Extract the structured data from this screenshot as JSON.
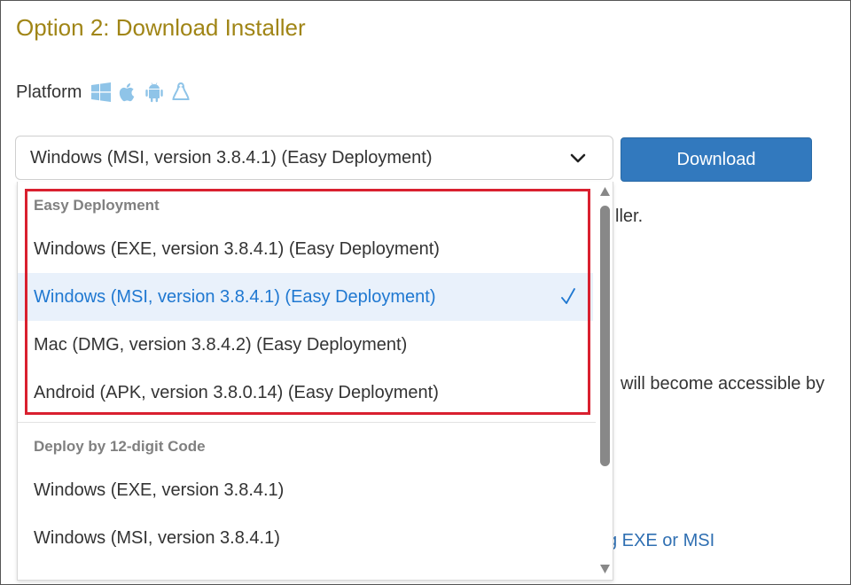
{
  "page": {
    "title": "Option 2: Download Installer",
    "platform_label": "Platform",
    "platform_icons": [
      "windows-icon",
      "apple-icon",
      "android-icon",
      "linux-icon"
    ]
  },
  "select": {
    "value": "Windows (MSI, version 3.8.4.1) (Easy Deployment)"
  },
  "download_button": {
    "label": "Download"
  },
  "background_text": {
    "line1_fragment": "ller.",
    "line2_fragment": "will become accessible by",
    "link_fragment": "g EXE or MSI"
  },
  "dropdown": {
    "groups": [
      {
        "header": "Easy Deployment",
        "options": [
          {
            "label": "Windows (EXE, version 3.8.4.1) (Easy Deployment)",
            "selected": false
          },
          {
            "label": "Windows (MSI, version 3.8.4.1) (Easy Deployment)",
            "selected": true
          },
          {
            "label": "Mac (DMG, version 3.8.4.2) (Easy Deployment)",
            "selected": false
          },
          {
            "label": "Android (APK, version 3.8.0.14) (Easy Deployment)",
            "selected": false
          }
        ]
      },
      {
        "header": "Deploy by 12-digit Code",
        "options": [
          {
            "label": "Windows (EXE, version 3.8.4.1)",
            "selected": false
          },
          {
            "label": "Windows (MSI, version 3.8.4.1)",
            "selected": false
          }
        ]
      }
    ]
  },
  "colors": {
    "title": "#a08516",
    "icon": "#8fc4e8",
    "button": "#3279be",
    "selected_text": "#1f78d1",
    "selected_bg": "#e9f1fb",
    "highlight": "#d9202f",
    "link": "#2f6fb2"
  }
}
